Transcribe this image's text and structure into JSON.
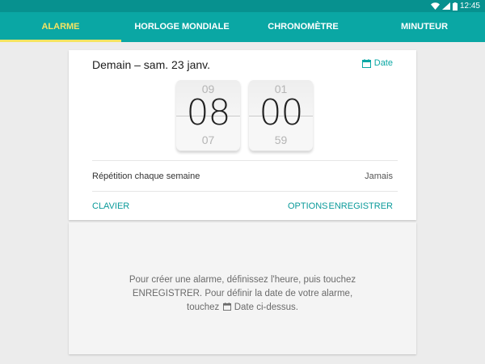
{
  "status_bar": {
    "time": "12:45",
    "icons": [
      "wifi-icon",
      "signal-icon",
      "battery-icon"
    ]
  },
  "tabs": [
    {
      "label": "ALARME",
      "active": true
    },
    {
      "label": "HORLOGE MONDIALE",
      "active": false
    },
    {
      "label": "CHRONOMÈTRE",
      "active": false
    },
    {
      "label": "MINUTEUR",
      "active": false
    }
  ],
  "alarm_card": {
    "title": "Demain – sam. 23 janv.",
    "date_button": "Date",
    "hour": {
      "prev": "09",
      "current": "08",
      "next": "07"
    },
    "minute": {
      "prev": "01",
      "current": "00",
      "next": "59"
    },
    "repeat_label": "Répétition chaque semaine",
    "repeat_value": "Jamais",
    "keyboard_button": "CLAVIER",
    "options_button": "OPTIONS",
    "save_button": "ENREGISTRER"
  },
  "empty_state": {
    "text_part1": "Pour créer une alarme, définissez l'heure, puis touchez ENREGISTRER. Pour définir la date de votre alarme, touchez",
    "text_part2": "Date ci-dessus."
  },
  "colors": {
    "status_bar": "#07918f",
    "tab_bar": "#0aa7a4",
    "active_tab": "#f5e462",
    "accent": "#0aa7a4"
  }
}
